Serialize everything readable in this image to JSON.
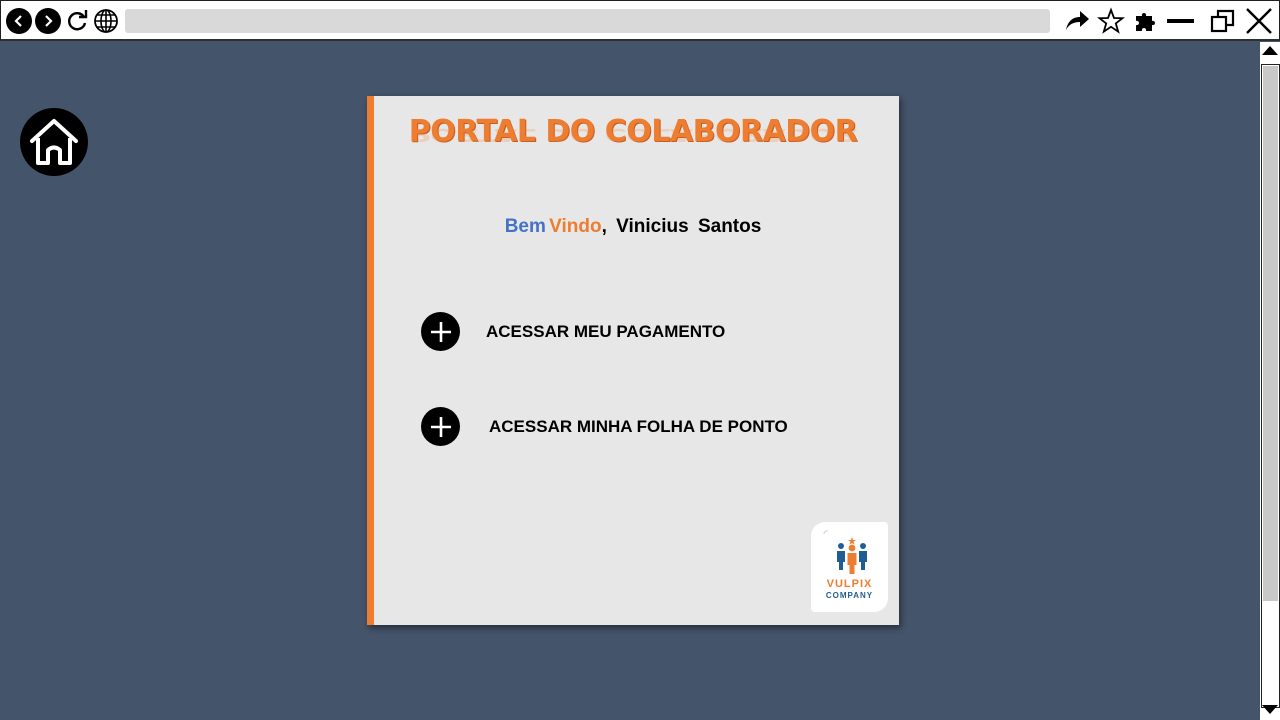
{
  "browser": {
    "icons": {
      "back": "chevron-left-icon",
      "forward": "chevron-right-icon",
      "reload": "reload-icon",
      "globe": "globe-icon",
      "share": "share-arrow-icon",
      "bookmark": "star-icon",
      "extensions": "puzzle-icon",
      "minimize": "minimize-icon",
      "restore": "restore-window-icon",
      "close": "close-icon"
    },
    "address": ""
  },
  "portal": {
    "title": "PORTAL DO COLABORADOR",
    "welcome": {
      "bem": "Bem",
      "vindo": "Vindo",
      "comma": ",",
      "first_name": "Vinicius",
      "last_name": "Santos"
    },
    "actions": [
      {
        "label": "ACESSAR MEU PAGAMENTO",
        "icon": "plus-circle-icon"
      },
      {
        "label": "ACESSAR MINHA FOLHA DE PONTO",
        "icon": "plus-circle-icon"
      }
    ],
    "logo": {
      "line1": "VULPIX",
      "line2": "COMPANY"
    }
  },
  "colors": {
    "background": "#44546a",
    "accent": "#ed7d31",
    "blue": "#4472c4",
    "card": "#e7e7e7"
  }
}
